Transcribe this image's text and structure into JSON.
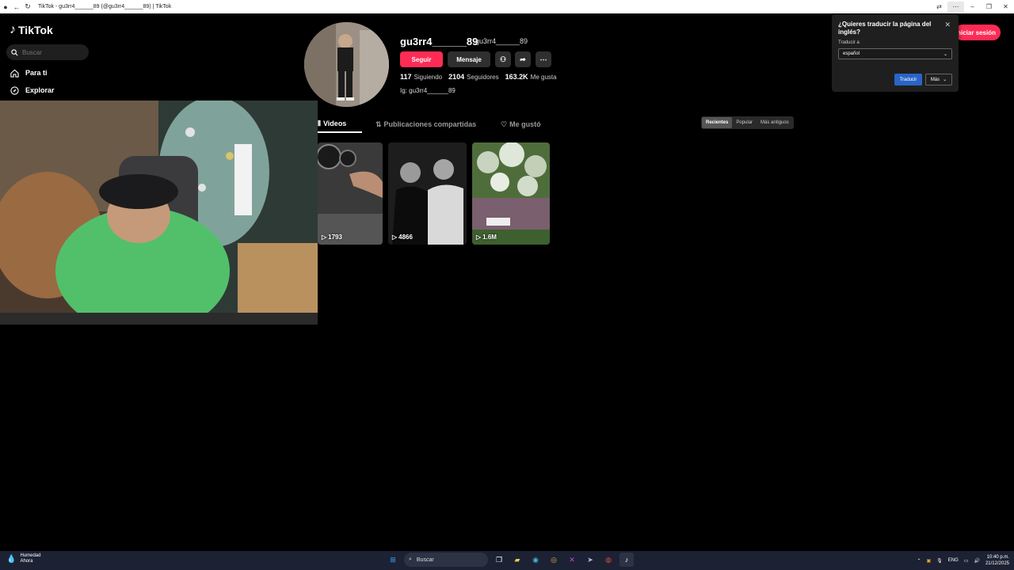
{
  "window": {
    "title": "TikTok - gu3rr4______89 (@gu3rr4______89) | TikTok"
  },
  "sidebar": {
    "logo_text": "TikTok",
    "search_placeholder": "Buscar",
    "items": [
      {
        "label": "Para ti",
        "icon": "home-icon"
      },
      {
        "label": "Explorar",
        "icon": "compass-icon"
      }
    ]
  },
  "profile": {
    "username": "gu3rr4______89",
    "nickname": "gu3rr4______89",
    "follow_label": "Seguir",
    "message_label": "Mensaje",
    "stats": {
      "following_count": "117",
      "following_label": "Siguiendo",
      "followers_count": "2104",
      "followers_label": "Seguidores",
      "likes_count": "163.2K",
      "likes_label": "Me gusta"
    },
    "bio": "Ig: gu3rr4______89"
  },
  "tabs": [
    {
      "label": "Videos",
      "active": true
    },
    {
      "label": "Publicaciones compartidas",
      "active": false
    },
    {
      "label": "Me gustó",
      "active": false
    }
  ],
  "sort": {
    "options": [
      "Recientes",
      "Popular",
      "Más antiguos"
    ],
    "selected": "Recientes"
  },
  "videos": [
    {
      "views": "1793"
    },
    {
      "views": "4866"
    },
    {
      "views": "1.6M"
    }
  ],
  "translate_popup": {
    "title": "¿Quieres traducir la página del inglés?",
    "translate_to_label": "Traducir a",
    "language": "español",
    "translate_button": "Traducir",
    "more_button": "Más"
  },
  "login_button": "Iniciar sesión",
  "taskbar": {
    "weather_title": "Humedad",
    "weather_sub": "Ahora",
    "search_label": "Buscar",
    "lang": "ENG",
    "time": "10:40 p.m.",
    "date": "21/12/2025"
  },
  "colors": {
    "accent": "#fe2c55",
    "background": "#000000",
    "translate_primary": "#2a64c8"
  }
}
